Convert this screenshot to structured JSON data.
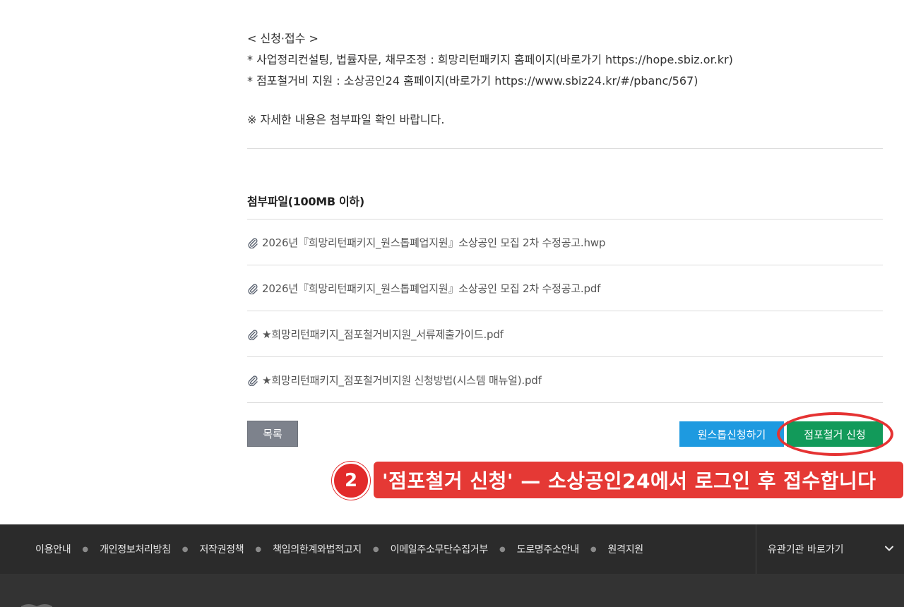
{
  "apply": {
    "heading": "< 신청·접수 >",
    "line1": " * 사업정리컨설팅, 법률자문, 채무조정 : 희망리턴패키지 홈페이지(바로가기 https://hope.sbiz.or.kr)",
    "line2": " * 점포철거비 지원 : 소상공인24 홈페이지(바로가기 https://www.sbiz24.kr/#/pbanc/567)"
  },
  "note": "※ 자세한 내용은 첨부파일 확인 바랍니다.",
  "attachments": {
    "title": "첨부파일(100MB 이하)",
    "files": [
      {
        "name": "2026년『희망리턴패키지_원스톱폐업지원』소상공인 모집 2차 수정공고.hwp"
      },
      {
        "name": "2026년『희망리턴패키지_원스톱폐업지원』소상공인 모집 2차 수정공고.pdf"
      },
      {
        "name": "★희망리턴패키지_점포철거비지원_서류제출가이드.pdf"
      },
      {
        "name": "★희망리턴패키지_점포철거비지원 신청방법(시스템 매뉴얼).pdf"
      }
    ]
  },
  "buttons": {
    "list": "목록",
    "onestop": "원스톱신청하기",
    "demolition": "점포철거 신청"
  },
  "annotation": {
    "step": "2",
    "text": "'점포철거 신청' — 소상공인24에서 로그인 후 접수합니다"
  },
  "footer": {
    "links": [
      "이용안내",
      "개인정보처리방침",
      "저작권정책",
      "책임의한계와법적고지",
      "이메일주소무단수집거부",
      "도로명주소안내",
      "원격지원"
    ],
    "family_site": "유관기관 바로가기"
  },
  "colors": {
    "onestop_button": "#1e9ae0",
    "demolition_button": "#129a5a",
    "list_button": "#7d828c",
    "annotation_red": "#e53935",
    "footer_bg": "#2b2b2b"
  },
  "icons": {
    "file": "paperclip-icon",
    "family_dropdown": "chevron-down-icon"
  }
}
